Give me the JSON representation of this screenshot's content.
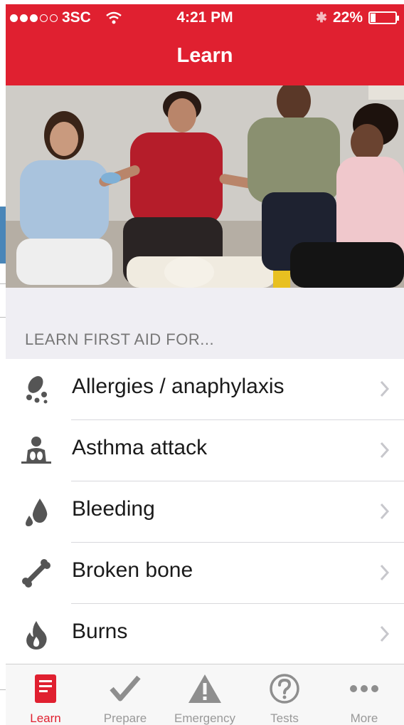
{
  "status_bar": {
    "carrier": "3SC",
    "time": "4:21 PM",
    "battery": "22%",
    "battery_level": 0.22
  },
  "header": {
    "title": "Learn"
  },
  "hero": {
    "image": "first-aid-class-photo"
  },
  "section": {
    "title": "LEARN FIRST AID FOR..."
  },
  "topics": [
    {
      "label": "Allergies / anaphylaxis",
      "icon": "allergy-icon"
    },
    {
      "label": "Asthma attack",
      "icon": "asthma-icon"
    },
    {
      "label": "Bleeding",
      "icon": "blood-drop-icon"
    },
    {
      "label": "Broken bone",
      "icon": "bone-icon"
    },
    {
      "label": "Burns",
      "icon": "flame-icon"
    }
  ],
  "tabs": [
    {
      "label": "Learn",
      "icon": "book-icon",
      "active": true
    },
    {
      "label": "Prepare",
      "icon": "checkmark-icon",
      "active": false
    },
    {
      "label": "Emergency",
      "icon": "warning-icon",
      "active": false
    },
    {
      "label": "Tests",
      "icon": "question-icon",
      "active": false
    },
    {
      "label": "More",
      "icon": "more-icon",
      "active": false
    }
  ],
  "colors": {
    "brand_red": "#e02030",
    "icon_gray": "#555555",
    "tab_inactive": "#999999"
  }
}
